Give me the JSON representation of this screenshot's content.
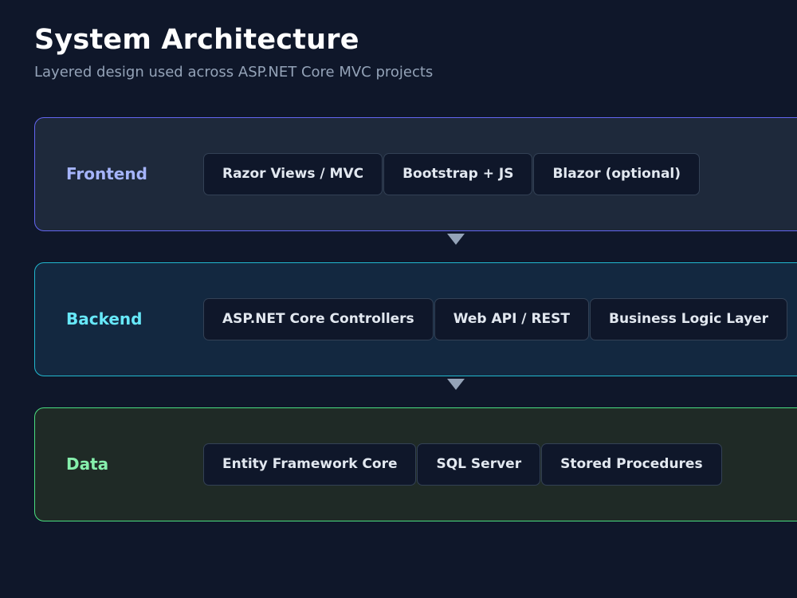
{
  "header": {
    "title": "System Architecture",
    "subtitle": "Layered design used across ASP.NET Core MVC projects"
  },
  "layers": [
    {
      "label": "Frontend",
      "color": "#a5b4fc",
      "items": [
        "Razor Views / MVC",
        "Bootstrap + JS",
        "Blazor (optional)"
      ]
    },
    {
      "label": "Backend",
      "color": "#67e8f9",
      "items": [
        "ASP.NET Core Controllers",
        "Web API / REST",
        "Business Logic Layer"
      ]
    },
    {
      "label": "Data",
      "color": "#86efac",
      "items": [
        "Entity Framework Core",
        "SQL Server",
        "Stored Procedures"
      ]
    }
  ],
  "arrows": [
    {
      "icon": "down-arrow-icon"
    },
    {
      "icon": "down-arrow-icon"
    }
  ]
}
